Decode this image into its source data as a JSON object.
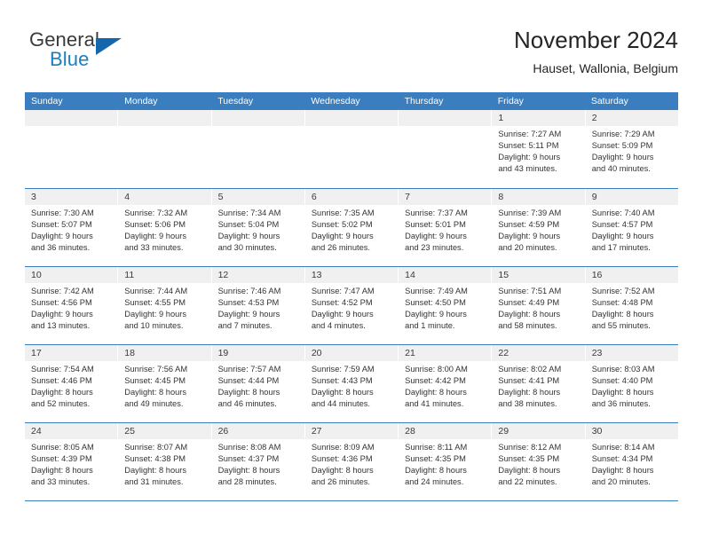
{
  "brand": {
    "word_general": "General",
    "word_blue": "Blue",
    "triangle_icon": "brand-triangle-icon"
  },
  "header": {
    "title": "November 2024",
    "subtitle": "Hauset, Wallonia, Belgium"
  },
  "colors": {
    "header_blue": "#3a7ebf",
    "brand_blue": "#1a7fc1",
    "daynum_band": "#f0f0f0",
    "text": "#333333"
  },
  "weekday_headers": [
    "Sunday",
    "Monday",
    "Tuesday",
    "Wednesday",
    "Thursday",
    "Friday",
    "Saturday"
  ],
  "weeks": [
    [
      {
        "empty": true,
        "day": "",
        "sunrise": "",
        "sunset": "",
        "daylight_line1": "",
        "daylight_line2": ""
      },
      {
        "empty": true,
        "day": "",
        "sunrise": "",
        "sunset": "",
        "daylight_line1": "",
        "daylight_line2": ""
      },
      {
        "empty": true,
        "day": "",
        "sunrise": "",
        "sunset": "",
        "daylight_line1": "",
        "daylight_line2": ""
      },
      {
        "empty": true,
        "day": "",
        "sunrise": "",
        "sunset": "",
        "daylight_line1": "",
        "daylight_line2": ""
      },
      {
        "empty": true,
        "day": "",
        "sunrise": "",
        "sunset": "",
        "daylight_line1": "",
        "daylight_line2": ""
      },
      {
        "empty": false,
        "day": "1",
        "sunrise": "Sunrise: 7:27 AM",
        "sunset": "Sunset: 5:11 PM",
        "daylight_line1": "Daylight: 9 hours",
        "daylight_line2": "and 43 minutes."
      },
      {
        "empty": false,
        "day": "2",
        "sunrise": "Sunrise: 7:29 AM",
        "sunset": "Sunset: 5:09 PM",
        "daylight_line1": "Daylight: 9 hours",
        "daylight_line2": "and 40 minutes."
      }
    ],
    [
      {
        "empty": false,
        "day": "3",
        "sunrise": "Sunrise: 7:30 AM",
        "sunset": "Sunset: 5:07 PM",
        "daylight_line1": "Daylight: 9 hours",
        "daylight_line2": "and 36 minutes."
      },
      {
        "empty": false,
        "day": "4",
        "sunrise": "Sunrise: 7:32 AM",
        "sunset": "Sunset: 5:06 PM",
        "daylight_line1": "Daylight: 9 hours",
        "daylight_line2": "and 33 minutes."
      },
      {
        "empty": false,
        "day": "5",
        "sunrise": "Sunrise: 7:34 AM",
        "sunset": "Sunset: 5:04 PM",
        "daylight_line1": "Daylight: 9 hours",
        "daylight_line2": "and 30 minutes."
      },
      {
        "empty": false,
        "day": "6",
        "sunrise": "Sunrise: 7:35 AM",
        "sunset": "Sunset: 5:02 PM",
        "daylight_line1": "Daylight: 9 hours",
        "daylight_line2": "and 26 minutes."
      },
      {
        "empty": false,
        "day": "7",
        "sunrise": "Sunrise: 7:37 AM",
        "sunset": "Sunset: 5:01 PM",
        "daylight_line1": "Daylight: 9 hours",
        "daylight_line2": "and 23 minutes."
      },
      {
        "empty": false,
        "day": "8",
        "sunrise": "Sunrise: 7:39 AM",
        "sunset": "Sunset: 4:59 PM",
        "daylight_line1": "Daylight: 9 hours",
        "daylight_line2": "and 20 minutes."
      },
      {
        "empty": false,
        "day": "9",
        "sunrise": "Sunrise: 7:40 AM",
        "sunset": "Sunset: 4:57 PM",
        "daylight_line1": "Daylight: 9 hours",
        "daylight_line2": "and 17 minutes."
      }
    ],
    [
      {
        "empty": false,
        "day": "10",
        "sunrise": "Sunrise: 7:42 AM",
        "sunset": "Sunset: 4:56 PM",
        "daylight_line1": "Daylight: 9 hours",
        "daylight_line2": "and 13 minutes."
      },
      {
        "empty": false,
        "day": "11",
        "sunrise": "Sunrise: 7:44 AM",
        "sunset": "Sunset: 4:55 PM",
        "daylight_line1": "Daylight: 9 hours",
        "daylight_line2": "and 10 minutes."
      },
      {
        "empty": false,
        "day": "12",
        "sunrise": "Sunrise: 7:46 AM",
        "sunset": "Sunset: 4:53 PM",
        "daylight_line1": "Daylight: 9 hours",
        "daylight_line2": "and 7 minutes."
      },
      {
        "empty": false,
        "day": "13",
        "sunrise": "Sunrise: 7:47 AM",
        "sunset": "Sunset: 4:52 PM",
        "daylight_line1": "Daylight: 9 hours",
        "daylight_line2": "and 4 minutes."
      },
      {
        "empty": false,
        "day": "14",
        "sunrise": "Sunrise: 7:49 AM",
        "sunset": "Sunset: 4:50 PM",
        "daylight_line1": "Daylight: 9 hours",
        "daylight_line2": "and 1 minute."
      },
      {
        "empty": false,
        "day": "15",
        "sunrise": "Sunrise: 7:51 AM",
        "sunset": "Sunset: 4:49 PM",
        "daylight_line1": "Daylight: 8 hours",
        "daylight_line2": "and 58 minutes."
      },
      {
        "empty": false,
        "day": "16",
        "sunrise": "Sunrise: 7:52 AM",
        "sunset": "Sunset: 4:48 PM",
        "daylight_line1": "Daylight: 8 hours",
        "daylight_line2": "and 55 minutes."
      }
    ],
    [
      {
        "empty": false,
        "day": "17",
        "sunrise": "Sunrise: 7:54 AM",
        "sunset": "Sunset: 4:46 PM",
        "daylight_line1": "Daylight: 8 hours",
        "daylight_line2": "and 52 minutes."
      },
      {
        "empty": false,
        "day": "18",
        "sunrise": "Sunrise: 7:56 AM",
        "sunset": "Sunset: 4:45 PM",
        "daylight_line1": "Daylight: 8 hours",
        "daylight_line2": "and 49 minutes."
      },
      {
        "empty": false,
        "day": "19",
        "sunrise": "Sunrise: 7:57 AM",
        "sunset": "Sunset: 4:44 PM",
        "daylight_line1": "Daylight: 8 hours",
        "daylight_line2": "and 46 minutes."
      },
      {
        "empty": false,
        "day": "20",
        "sunrise": "Sunrise: 7:59 AM",
        "sunset": "Sunset: 4:43 PM",
        "daylight_line1": "Daylight: 8 hours",
        "daylight_line2": "and 44 minutes."
      },
      {
        "empty": false,
        "day": "21",
        "sunrise": "Sunrise: 8:00 AM",
        "sunset": "Sunset: 4:42 PM",
        "daylight_line1": "Daylight: 8 hours",
        "daylight_line2": "and 41 minutes."
      },
      {
        "empty": false,
        "day": "22",
        "sunrise": "Sunrise: 8:02 AM",
        "sunset": "Sunset: 4:41 PM",
        "daylight_line1": "Daylight: 8 hours",
        "daylight_line2": "and 38 minutes."
      },
      {
        "empty": false,
        "day": "23",
        "sunrise": "Sunrise: 8:03 AM",
        "sunset": "Sunset: 4:40 PM",
        "daylight_line1": "Daylight: 8 hours",
        "daylight_line2": "and 36 minutes."
      }
    ],
    [
      {
        "empty": false,
        "day": "24",
        "sunrise": "Sunrise: 8:05 AM",
        "sunset": "Sunset: 4:39 PM",
        "daylight_line1": "Daylight: 8 hours",
        "daylight_line2": "and 33 minutes."
      },
      {
        "empty": false,
        "day": "25",
        "sunrise": "Sunrise: 8:07 AM",
        "sunset": "Sunset: 4:38 PM",
        "daylight_line1": "Daylight: 8 hours",
        "daylight_line2": "and 31 minutes."
      },
      {
        "empty": false,
        "day": "26",
        "sunrise": "Sunrise: 8:08 AM",
        "sunset": "Sunset: 4:37 PM",
        "daylight_line1": "Daylight: 8 hours",
        "daylight_line2": "and 28 minutes."
      },
      {
        "empty": false,
        "day": "27",
        "sunrise": "Sunrise: 8:09 AM",
        "sunset": "Sunset: 4:36 PM",
        "daylight_line1": "Daylight: 8 hours",
        "daylight_line2": "and 26 minutes."
      },
      {
        "empty": false,
        "day": "28",
        "sunrise": "Sunrise: 8:11 AM",
        "sunset": "Sunset: 4:35 PM",
        "daylight_line1": "Daylight: 8 hours",
        "daylight_line2": "and 24 minutes."
      },
      {
        "empty": false,
        "day": "29",
        "sunrise": "Sunrise: 8:12 AM",
        "sunset": "Sunset: 4:35 PM",
        "daylight_line1": "Daylight: 8 hours",
        "daylight_line2": "and 22 minutes."
      },
      {
        "empty": false,
        "day": "30",
        "sunrise": "Sunrise: 8:14 AM",
        "sunset": "Sunset: 4:34 PM",
        "daylight_line1": "Daylight: 8 hours",
        "daylight_line2": "and 20 minutes."
      }
    ]
  ]
}
